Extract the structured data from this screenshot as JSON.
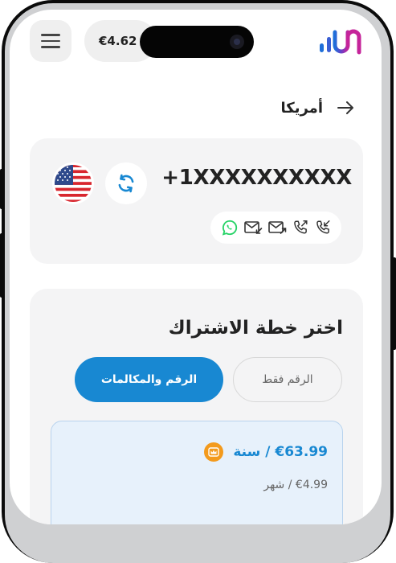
{
  "header": {
    "balance": "€4.62",
    "menu_icon": "hamburger-icon",
    "logo_icon": "brand-logo-icon"
  },
  "page": {
    "title": "أمريكا",
    "back_icon": "arrow-right-icon"
  },
  "number_card": {
    "phone_number": "+1XXXXXXXXXX",
    "flag_icon": "us-flag-icon",
    "refresh_icon": "refresh-icon",
    "capabilities": [
      "whatsapp-icon",
      "sms-incoming-icon",
      "sms-outgoing-icon",
      "call-outgoing-icon",
      "call-incoming-icon"
    ]
  },
  "plans": {
    "title": "اختر خطة الاشتراك",
    "tabs": [
      {
        "label": "الرقم فقط",
        "selected": false
      },
      {
        "label": "الرقم والمكالمات",
        "selected": true
      }
    ],
    "selected_plan": {
      "yearly_price": "€63.99 / سنة",
      "monthly_price": "€4.99 / شهر"
    }
  },
  "colors": {
    "accent": "#1888d2",
    "crown": "#f39a1c",
    "whatsapp": "#25d366",
    "logo_start": "#1e6fd9",
    "logo_end": "#c5249a"
  }
}
